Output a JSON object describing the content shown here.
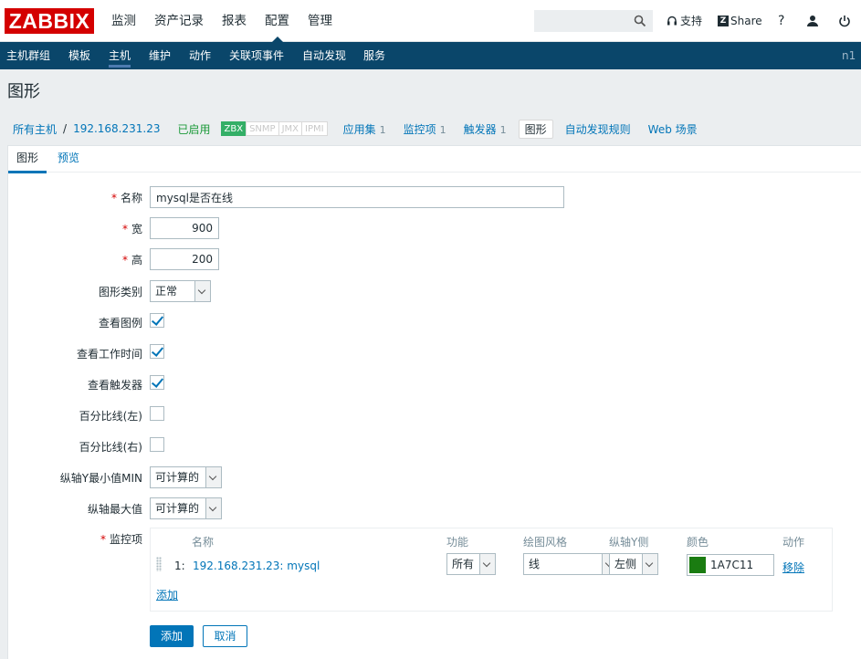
{
  "header": {
    "logo": "ZABBIX",
    "menu": [
      "监测",
      "资产记录",
      "报表",
      "配置",
      "管理"
    ],
    "active_menu": "配置",
    "support_label": "支持",
    "share_label": "Share",
    "help_label": "?",
    "search_placeholder": ""
  },
  "subnav": {
    "items": [
      "主机群组",
      "模板",
      "主机",
      "维护",
      "动作",
      "关联项事件",
      "自动发现",
      "服务"
    ],
    "active": "主机",
    "right_label": "n1"
  },
  "page_title": "图形",
  "breadcrumb": {
    "all_hosts": "所有主机",
    "separator": "/",
    "host": "192.168.231.23",
    "status": "已启用",
    "badges": [
      "ZBX",
      "SNMP",
      "JMX",
      "IPMI"
    ],
    "links": [
      {
        "label": "应用集",
        "count": "1"
      },
      {
        "label": "监控项",
        "count": "1"
      },
      {
        "label": "触发器",
        "count": "1"
      },
      {
        "label": "图形",
        "count": ""
      },
      {
        "label": "自动发现规则",
        "count": ""
      },
      {
        "label": "Web 场景",
        "count": ""
      }
    ]
  },
  "tabs": [
    "图形",
    "预览"
  ],
  "form": {
    "required_mark": "*",
    "name": {
      "label": "名称",
      "value": "mysql是否在线"
    },
    "width": {
      "label": "宽",
      "value": "900"
    },
    "height": {
      "label": "高",
      "value": "200"
    },
    "graph_type": {
      "label": "图形类别",
      "value": "正常"
    },
    "show_legend": {
      "label": "查看图例",
      "checked": true
    },
    "show_work_period": {
      "label": "查看工作时间",
      "checked": true
    },
    "show_triggers": {
      "label": "查看触发器",
      "checked": true
    },
    "percentile_left": {
      "label": "百分比线(左)",
      "checked": false
    },
    "percentile_right": {
      "label": "百分比线(右)",
      "checked": false
    },
    "ymin": {
      "label": "纵轴Y最小值MIN",
      "value": "可计算的"
    },
    "ymax": {
      "label": "纵轴最大值",
      "value": "可计算的"
    },
    "items_label": "监控项",
    "items_table": {
      "headers": [
        "名称",
        "功能",
        "绘图风格",
        "纵轴Y侧",
        "颜色",
        "动作"
      ],
      "rows": [
        {
          "index": "1:",
          "name": "192.168.231.23: mysql",
          "function": "所有",
          "style": "线",
          "y_side": "左侧",
          "color_hex": "1A7C11",
          "color": "#1A7C11",
          "action": "移除"
        }
      ],
      "add_link": "添加"
    },
    "buttons": {
      "add": "添加",
      "cancel": "取消"
    }
  }
}
